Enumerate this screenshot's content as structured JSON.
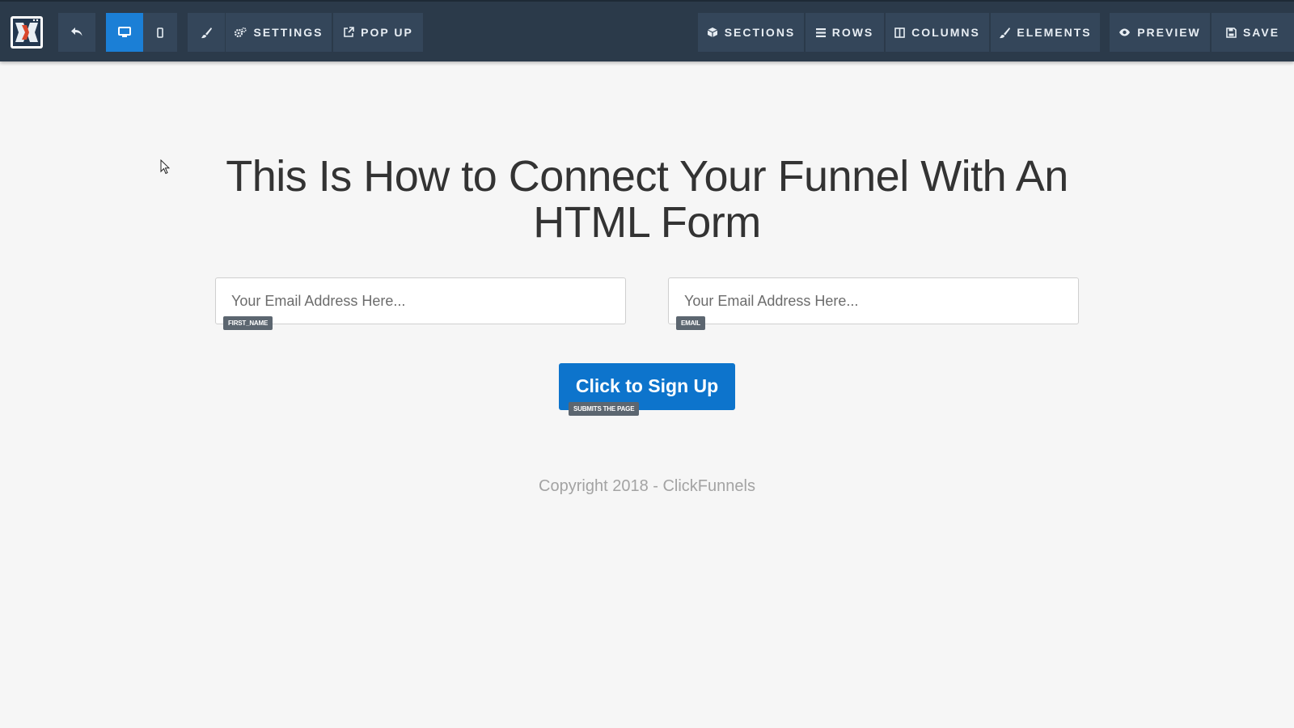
{
  "colors": {
    "toolbar_bg": "#2b3a4a",
    "toolbar_button": "#34465a",
    "active_button": "#1b7fd6",
    "primary_button": "#0d74cc",
    "page_bg": "#f6f6f6"
  },
  "toolbar": {
    "logo_icon": "clickfunnels-logo-icon",
    "left_buttons": [
      {
        "name": "undo",
        "icon": "undo-icon",
        "label": ""
      },
      {
        "name": "desktop-view",
        "icon": "desktop-icon",
        "label": "",
        "active": true
      },
      {
        "name": "mobile-view",
        "icon": "mobile-icon",
        "label": ""
      },
      {
        "name": "style",
        "icon": "paintbrush-icon",
        "label": ""
      },
      {
        "name": "settings",
        "icon": "gears-icon",
        "label": "SETTINGS"
      },
      {
        "name": "popup",
        "icon": "external-link-icon",
        "label": "POP UP"
      }
    ],
    "right_buttons": [
      {
        "name": "sections",
        "icon": "cube-icon",
        "label": "SECTIONS"
      },
      {
        "name": "rows",
        "icon": "bars-icon",
        "label": "ROWS"
      },
      {
        "name": "columns",
        "icon": "columns-icon",
        "label": "COLUMNS"
      },
      {
        "name": "elements",
        "icon": "rocket-icon",
        "label": "ELEMENTS"
      },
      {
        "name": "preview",
        "icon": "eye-icon",
        "label": "PREVIEW"
      },
      {
        "name": "save",
        "icon": "floppy-icon",
        "label": "SAVE"
      }
    ]
  },
  "page": {
    "headline_line1": "This Is How to Connect Your Funnel With An",
    "headline_line2": "HTML Form",
    "fields": [
      {
        "placeholder": "Your Email Address Here...",
        "tag": "FIRST_NAME"
      },
      {
        "placeholder": "Your Email Address Here...",
        "tag": "EMAIL"
      }
    ],
    "button": {
      "label": "Click to Sign Up",
      "tag": "SUBMITS THE PAGE"
    },
    "copyright": "Copyright 2018 - ClickFunnels"
  }
}
